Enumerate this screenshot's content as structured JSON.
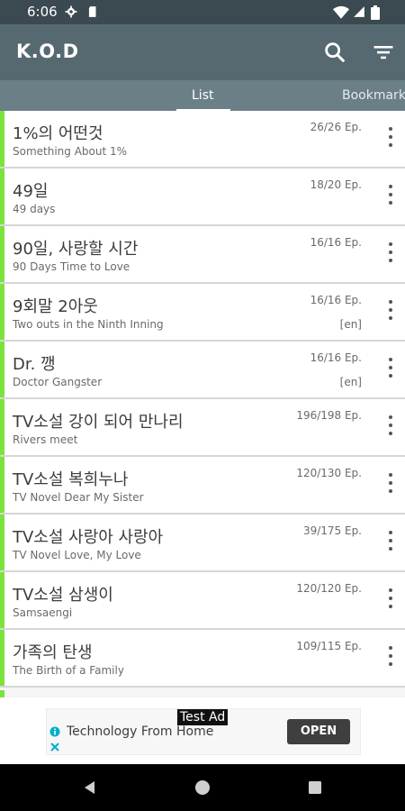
{
  "status_bar": {
    "time": "6:06",
    "icons": [
      "gear-icon",
      "sd-card-icon",
      "wifi-icon",
      "signal-icon",
      "battery-icon"
    ]
  },
  "app_bar": {
    "title": "K.O.D",
    "actions": [
      "search-icon",
      "filter-icon"
    ]
  },
  "tabs": [
    {
      "label": "List",
      "active": true
    },
    {
      "label": "Bookmark",
      "active": false
    }
  ],
  "list": [
    {
      "title": "1%의 어떤것",
      "subtitle": "Something About 1%",
      "episodes": "26/26 Ep.",
      "lang": ""
    },
    {
      "title": "49일",
      "subtitle": "49 days",
      "episodes": "18/20 Ep.",
      "lang": ""
    },
    {
      "title": "90일, 사랑할 시간",
      "subtitle": "90 Days Time to Love",
      "episodes": "16/16 Ep.",
      "lang": ""
    },
    {
      "title": "9회말 2아웃",
      "subtitle": "Two outs in the Ninth Inning",
      "episodes": "16/16 Ep.",
      "lang": "[en]"
    },
    {
      "title": "Dr. 깽",
      "subtitle": "Doctor Gangster",
      "episodes": "16/16 Ep.",
      "lang": "[en]"
    },
    {
      "title": "TV소설 강이 되어 만나리",
      "subtitle": "Rivers meet",
      "episodes": "196/198 Ep.",
      "lang": ""
    },
    {
      "title": "TV소설 복희누나",
      "subtitle": "TV Novel Dear My Sister",
      "episodes": "120/130 Ep.",
      "lang": ""
    },
    {
      "title": "TV소설 사랑아 사랑아",
      "subtitle": "TV Novel Love, My Love",
      "episodes": "39/175 Ep.",
      "lang": ""
    },
    {
      "title": "TV소설 삼생이",
      "subtitle": "Samsaengi",
      "episodes": "120/120 Ep.",
      "lang": ""
    },
    {
      "title": "가족의 탄생",
      "subtitle": "The Birth of a Family",
      "episodes": "109/115 Ep.",
      "lang": ""
    }
  ],
  "ad": {
    "label": "Test Ad",
    "text": "Technology From Home",
    "button": "OPEN"
  },
  "nav_bar": {
    "icons": [
      "back-icon",
      "home-icon",
      "recents-icon"
    ]
  },
  "colors": {
    "status_bar": "#3b4a50",
    "app_bar": "#566970",
    "tab_bar": "#6b7f87",
    "accent_green": "#7ee23d"
  }
}
